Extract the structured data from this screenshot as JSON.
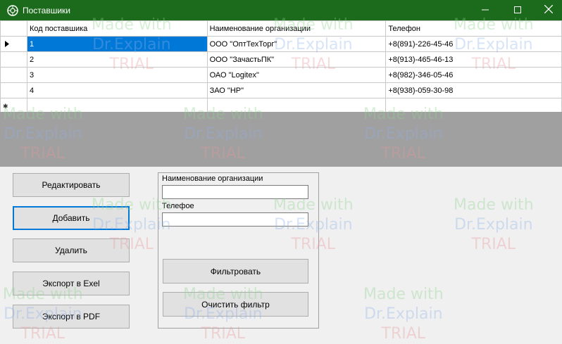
{
  "window": {
    "title": "Поставшики"
  },
  "grid": {
    "columns": [
      "Код поставшика",
      "Наименование организации",
      "Телефон"
    ],
    "rows": [
      [
        "1",
        "ООО \"ОптТехТорг\"",
        "+8(891)-226-45-46"
      ],
      [
        "2",
        "ООО \"ЗачастьПК\"",
        "+8(913)-465-46-13"
      ],
      [
        "3",
        "ОАО \"Logitex\"",
        "+8(982)-346-05-46"
      ],
      [
        "4",
        "ЗАО \"НР\"",
        "+8(938)-059-30-98"
      ]
    ]
  },
  "buttons": {
    "edit": "Редактировать",
    "add": "Добавить",
    "delete": "Удалить",
    "export_excel": "Экспорт в Exel",
    "export_pdf": "Экспорт в PDF"
  },
  "filter": {
    "org_label": "Наименование организации",
    "org_value": "",
    "phone_label": "Телефое",
    "phone_value": "",
    "apply": "Фильтровать",
    "clear": "Очистить фильтр"
  },
  "watermark": {
    "line1": "Made with",
    "line2": "Dr.Explain",
    "line3": "TRIAL"
  },
  "icons": {
    "app": "app-logo-icon",
    "minimize": "minimize-icon",
    "maximize": "maximize-icon",
    "close": "close-icon",
    "row_pointer": "row-pointer-icon",
    "new_row": "new-row-icon"
  }
}
